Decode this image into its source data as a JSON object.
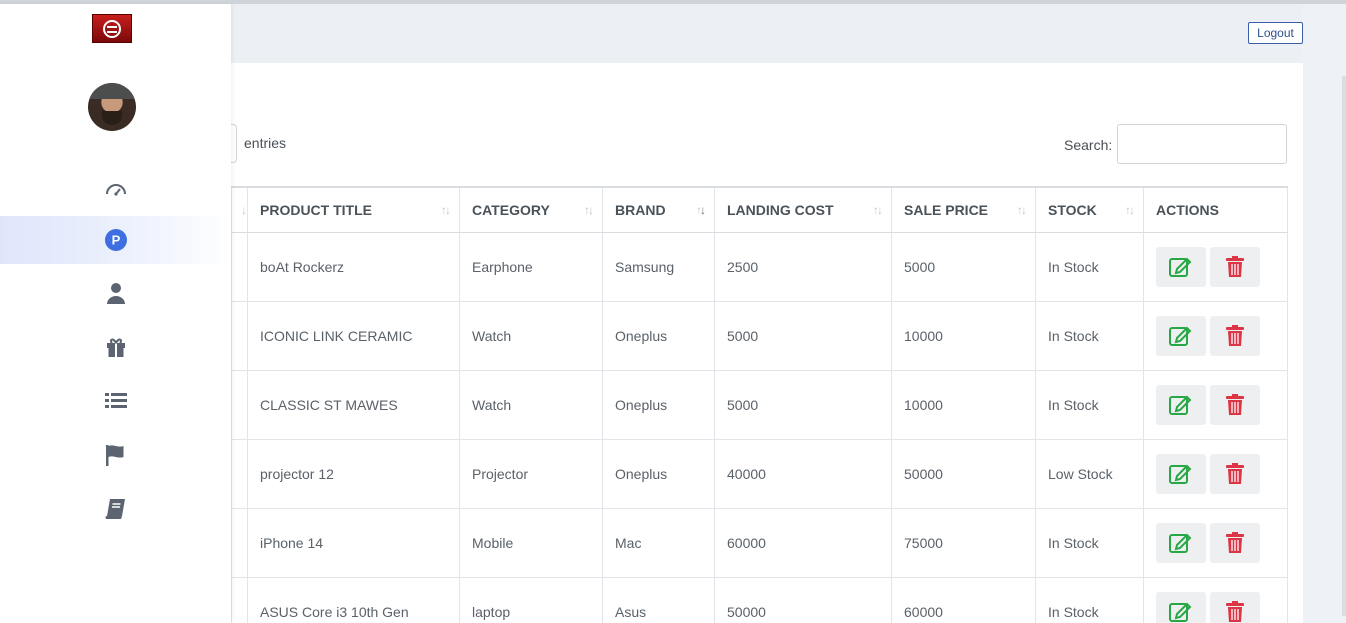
{
  "header": {
    "logout_label": "Logout"
  },
  "table_controls": {
    "entries_label": "entries",
    "search_label": "Search:",
    "search_value": ""
  },
  "sidebar": {
    "items": [
      {
        "icon": "speedometer-icon",
        "active": false
      },
      {
        "icon": "product-p-icon",
        "active": true
      },
      {
        "icon": "user-icon",
        "active": false
      },
      {
        "icon": "gift-icon",
        "active": false
      },
      {
        "icon": "list-icon",
        "active": false
      },
      {
        "icon": "flag-icon",
        "active": false
      },
      {
        "icon": "book-icon",
        "active": false
      }
    ]
  },
  "table": {
    "columns": [
      "PRODUCT TITLE",
      "CATEGORY",
      "BRAND",
      "LANDING COST",
      "SALE PRICE",
      "STOCK",
      "ACTIONS"
    ],
    "rows": [
      [
        "boAt Rockerz",
        "Earphone",
        "Samsung",
        "2500",
        "5000",
        "In Stock"
      ],
      [
        "ICONIC LINK CERAMIC",
        "Watch",
        "Oneplus",
        "5000",
        "10000",
        "In Stock"
      ],
      [
        "CLASSIC ST MAWES",
        "Watch",
        "Oneplus",
        "5000",
        "10000",
        "In Stock"
      ],
      [
        "projector 12",
        "Projector",
        "Oneplus",
        "40000",
        "50000",
        "Low Stock"
      ],
      [
        "iPhone 14",
        "Mobile",
        "Mac",
        "60000",
        "75000",
        "In Stock"
      ],
      [
        "ASUS Core i3 10th Gen",
        "laptop",
        "Asus",
        "50000",
        "60000",
        "In Stock"
      ]
    ]
  },
  "colors": {
    "edit": "#28a745",
    "delete": "#dc3545",
    "active_nav": "#3e6fe0",
    "logout_border": "#3b5ea8"
  }
}
